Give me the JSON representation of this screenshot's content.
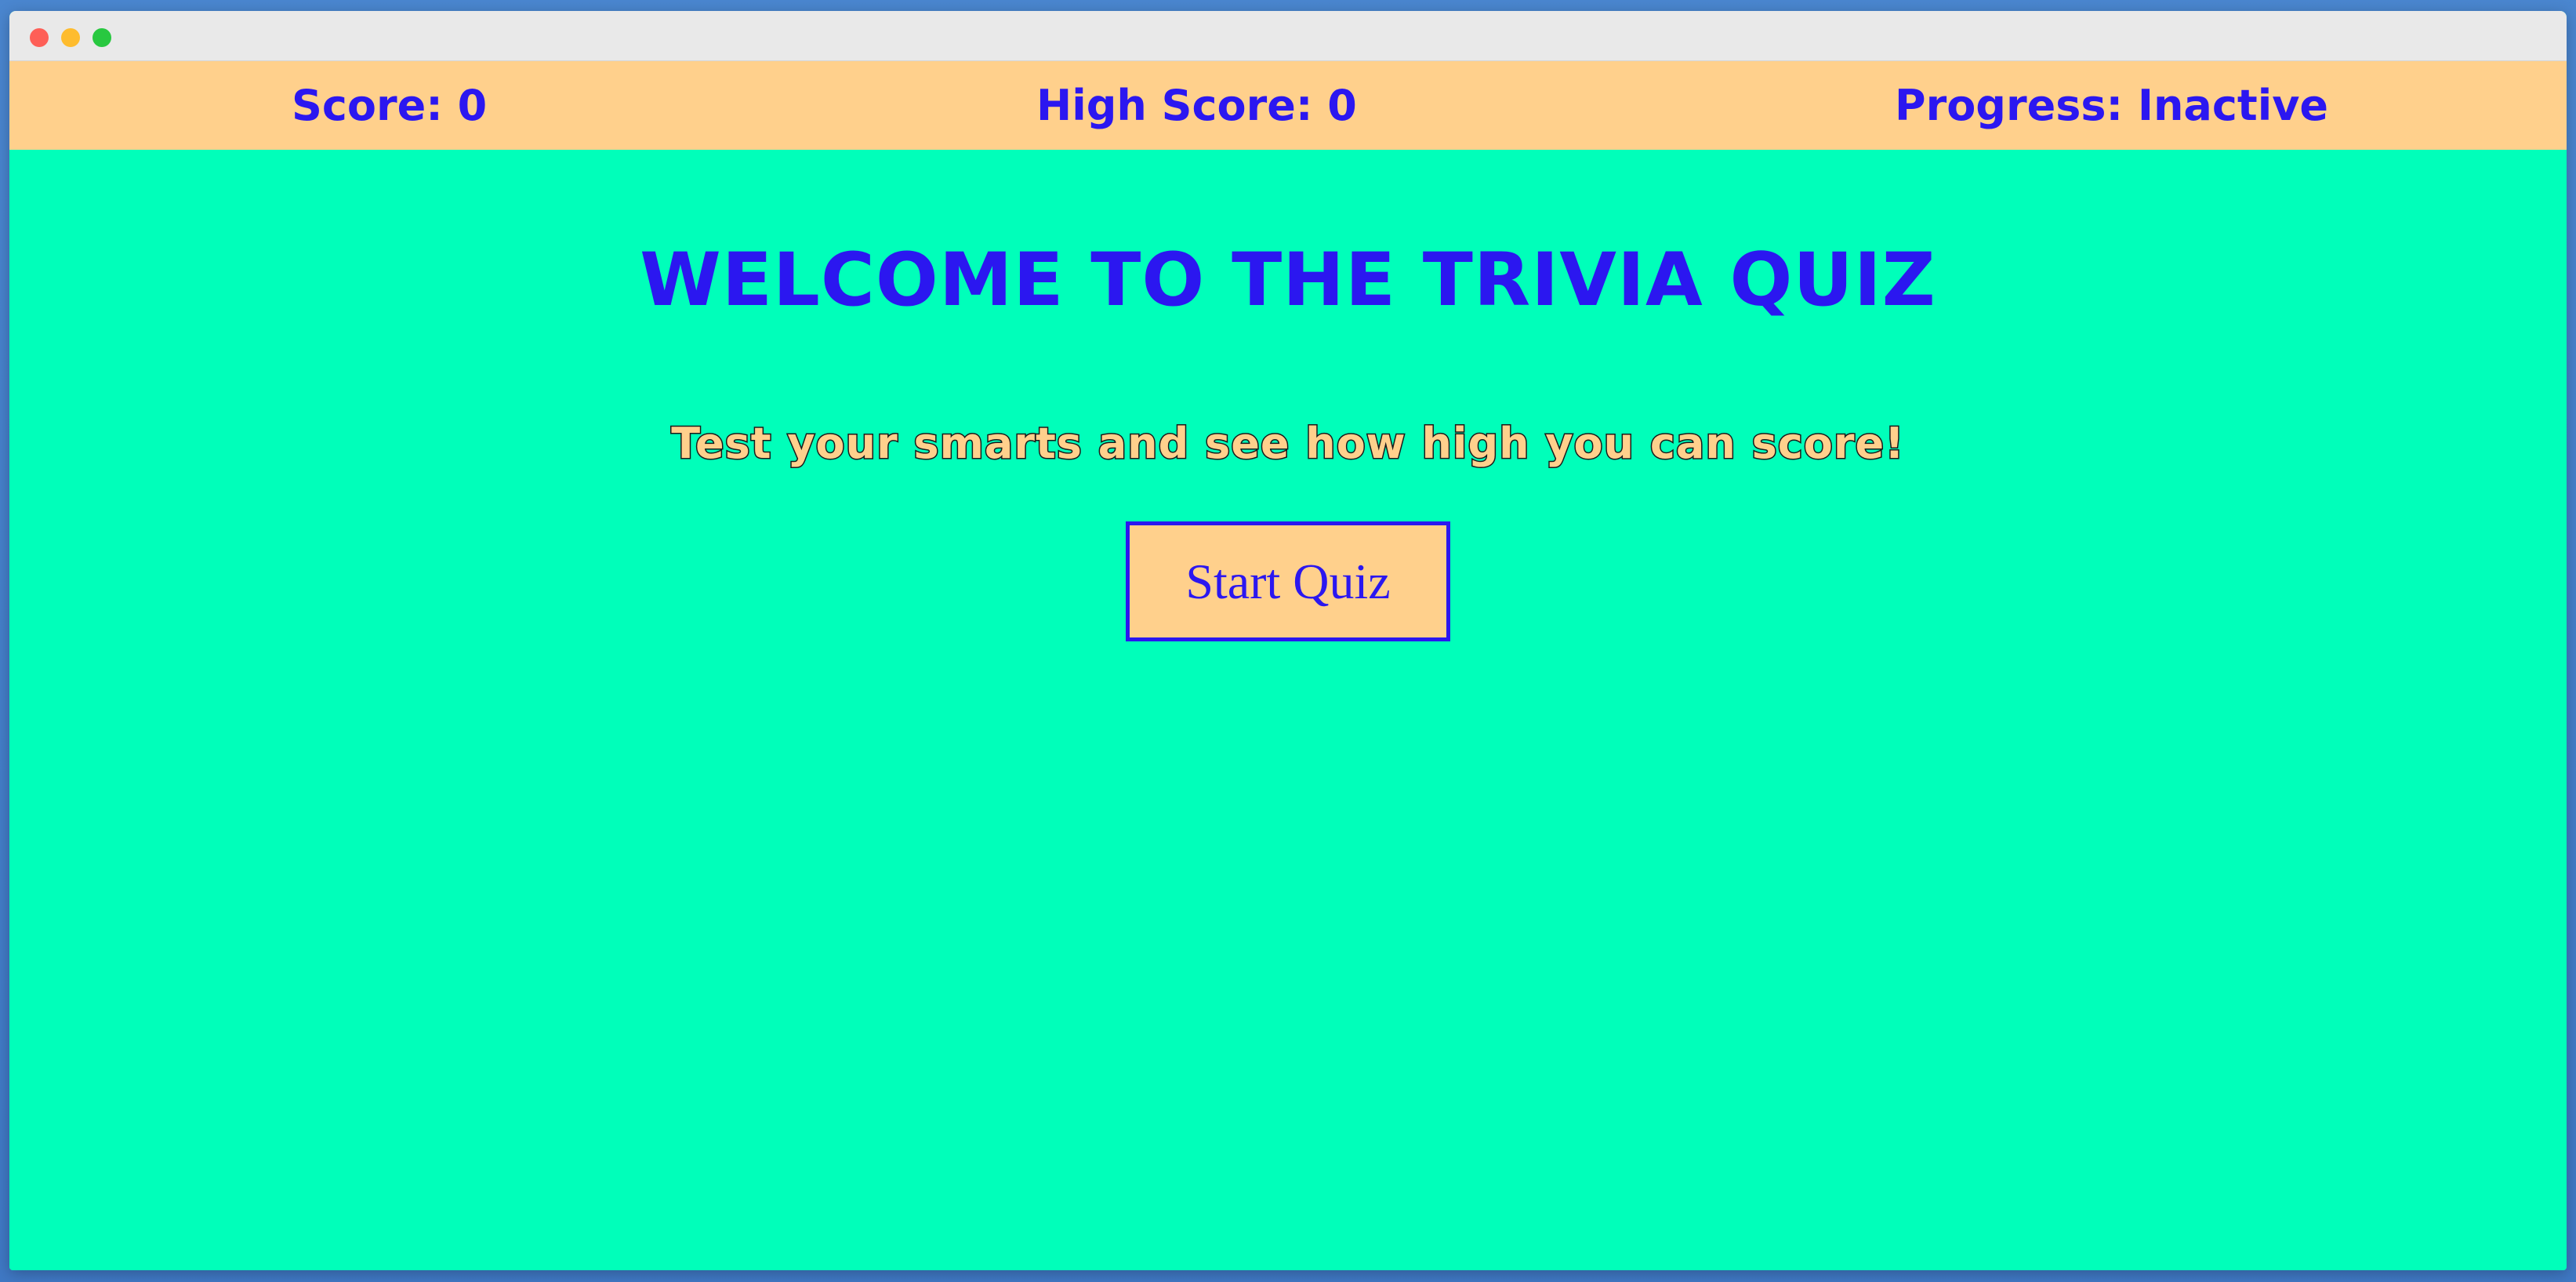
{
  "window": {
    "controls": [
      "close",
      "minimize",
      "maximize"
    ]
  },
  "status": {
    "score_label": "Score: 0",
    "high_score_label": "High Score: 0",
    "progress_label": "Progress: Inactive"
  },
  "main": {
    "title": "Welcome to the Trivia Quiz",
    "subtitle": "Test your smarts and see how high you can score!",
    "start_button_label": "Start Quiz"
  },
  "colors": {
    "background": "#00ffba",
    "status_bar": "#ffd08c",
    "accent_text": "#2b17f0",
    "button_fill": "#ffd08c"
  }
}
